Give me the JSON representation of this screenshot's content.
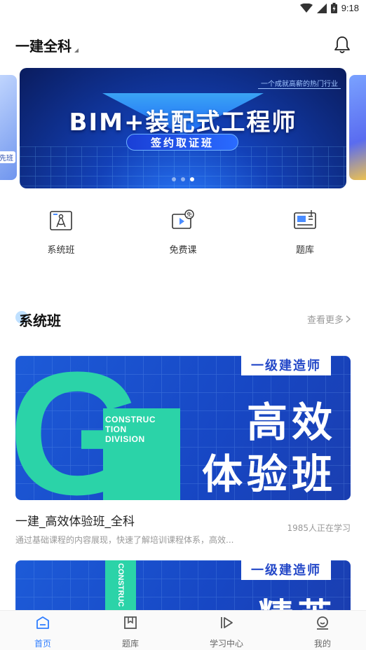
{
  "status_bar": {
    "time": "9:18"
  },
  "header": {
    "subject": "一建全科"
  },
  "banner": {
    "tag": "一个成就高薪的热门行业",
    "title": "BIM+装配式工程师",
    "subtitle": "签约取证班",
    "side_left_label": "先班",
    "dots": 3,
    "active_dot": 2
  },
  "quick_nav": [
    {
      "label": "系统班",
      "icon": "compass-icon"
    },
    {
      "label": "免费课",
      "icon": "free-video-icon"
    },
    {
      "label": "题库",
      "icon": "question-bank-icon"
    }
  ],
  "section": {
    "title": "系统班",
    "more_label": "查看更多"
  },
  "courses": [
    {
      "level_tag": "一级建造师",
      "cons_text": "CONSTRUC\nTION\nDIVISION",
      "big_line1": "高效",
      "big_line2": "体验班",
      "name": "一建_高效体验班_全科",
      "count": "1985人正在学习",
      "desc": "通过基础课程的内容展现，快速了解培训课程体系，高效..."
    },
    {
      "level_tag": "一级建造师",
      "cons_text": "CONSTRUC\nTION",
      "big_line1": "精英"
    }
  ],
  "tabbar": [
    {
      "label": "首页",
      "icon": "home-icon",
      "active": true
    },
    {
      "label": "题库",
      "icon": "bookmark-icon",
      "active": false
    },
    {
      "label": "学习中心",
      "icon": "play-icon",
      "active": false
    },
    {
      "label": "我的",
      "icon": "profile-icon",
      "active": false
    }
  ],
  "colors": {
    "accent": "#2f7dff",
    "teal": "#2bd3a8",
    "banner_blue": "#1341b8"
  }
}
